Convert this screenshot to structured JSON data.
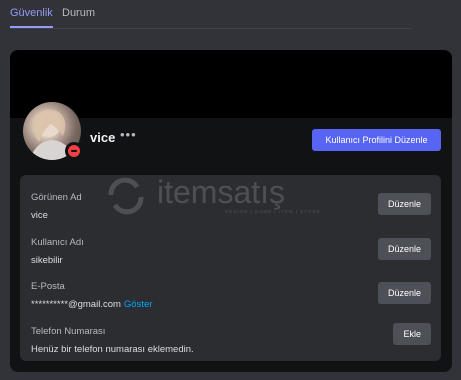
{
  "tabs": [
    {
      "label": "Güvenlik",
      "active": true
    },
    {
      "label": "Durum",
      "active": false
    }
  ],
  "profile": {
    "username": "vice",
    "more_glyph": "•••",
    "edit_profile_label": "Kullanıcı Profilini Düzenle",
    "status_color": "#f23f43"
  },
  "watermark": {
    "brand": "itemsatış",
    "tagline": "DESIGN  |  GAME  |  ITEM  |  STORE"
  },
  "fields": [
    {
      "label": "Görünen Ad",
      "value": "vice",
      "button": "Düzenle"
    },
    {
      "label": "Kullanıcı Adı",
      "value": "sikebilir",
      "button": "Düzenle"
    },
    {
      "label": "E-Posta",
      "value": "**********@gmail.com",
      "reveal": "Göster",
      "button": "Düzenle"
    },
    {
      "label": "Telefon Numarası",
      "value": "Henüz bir telefon numarası eklemedin.",
      "button": "Ekle"
    }
  ],
  "colors": {
    "accent": "#5865f2",
    "tab_active": "#949cf7",
    "link": "#00a8fc"
  }
}
